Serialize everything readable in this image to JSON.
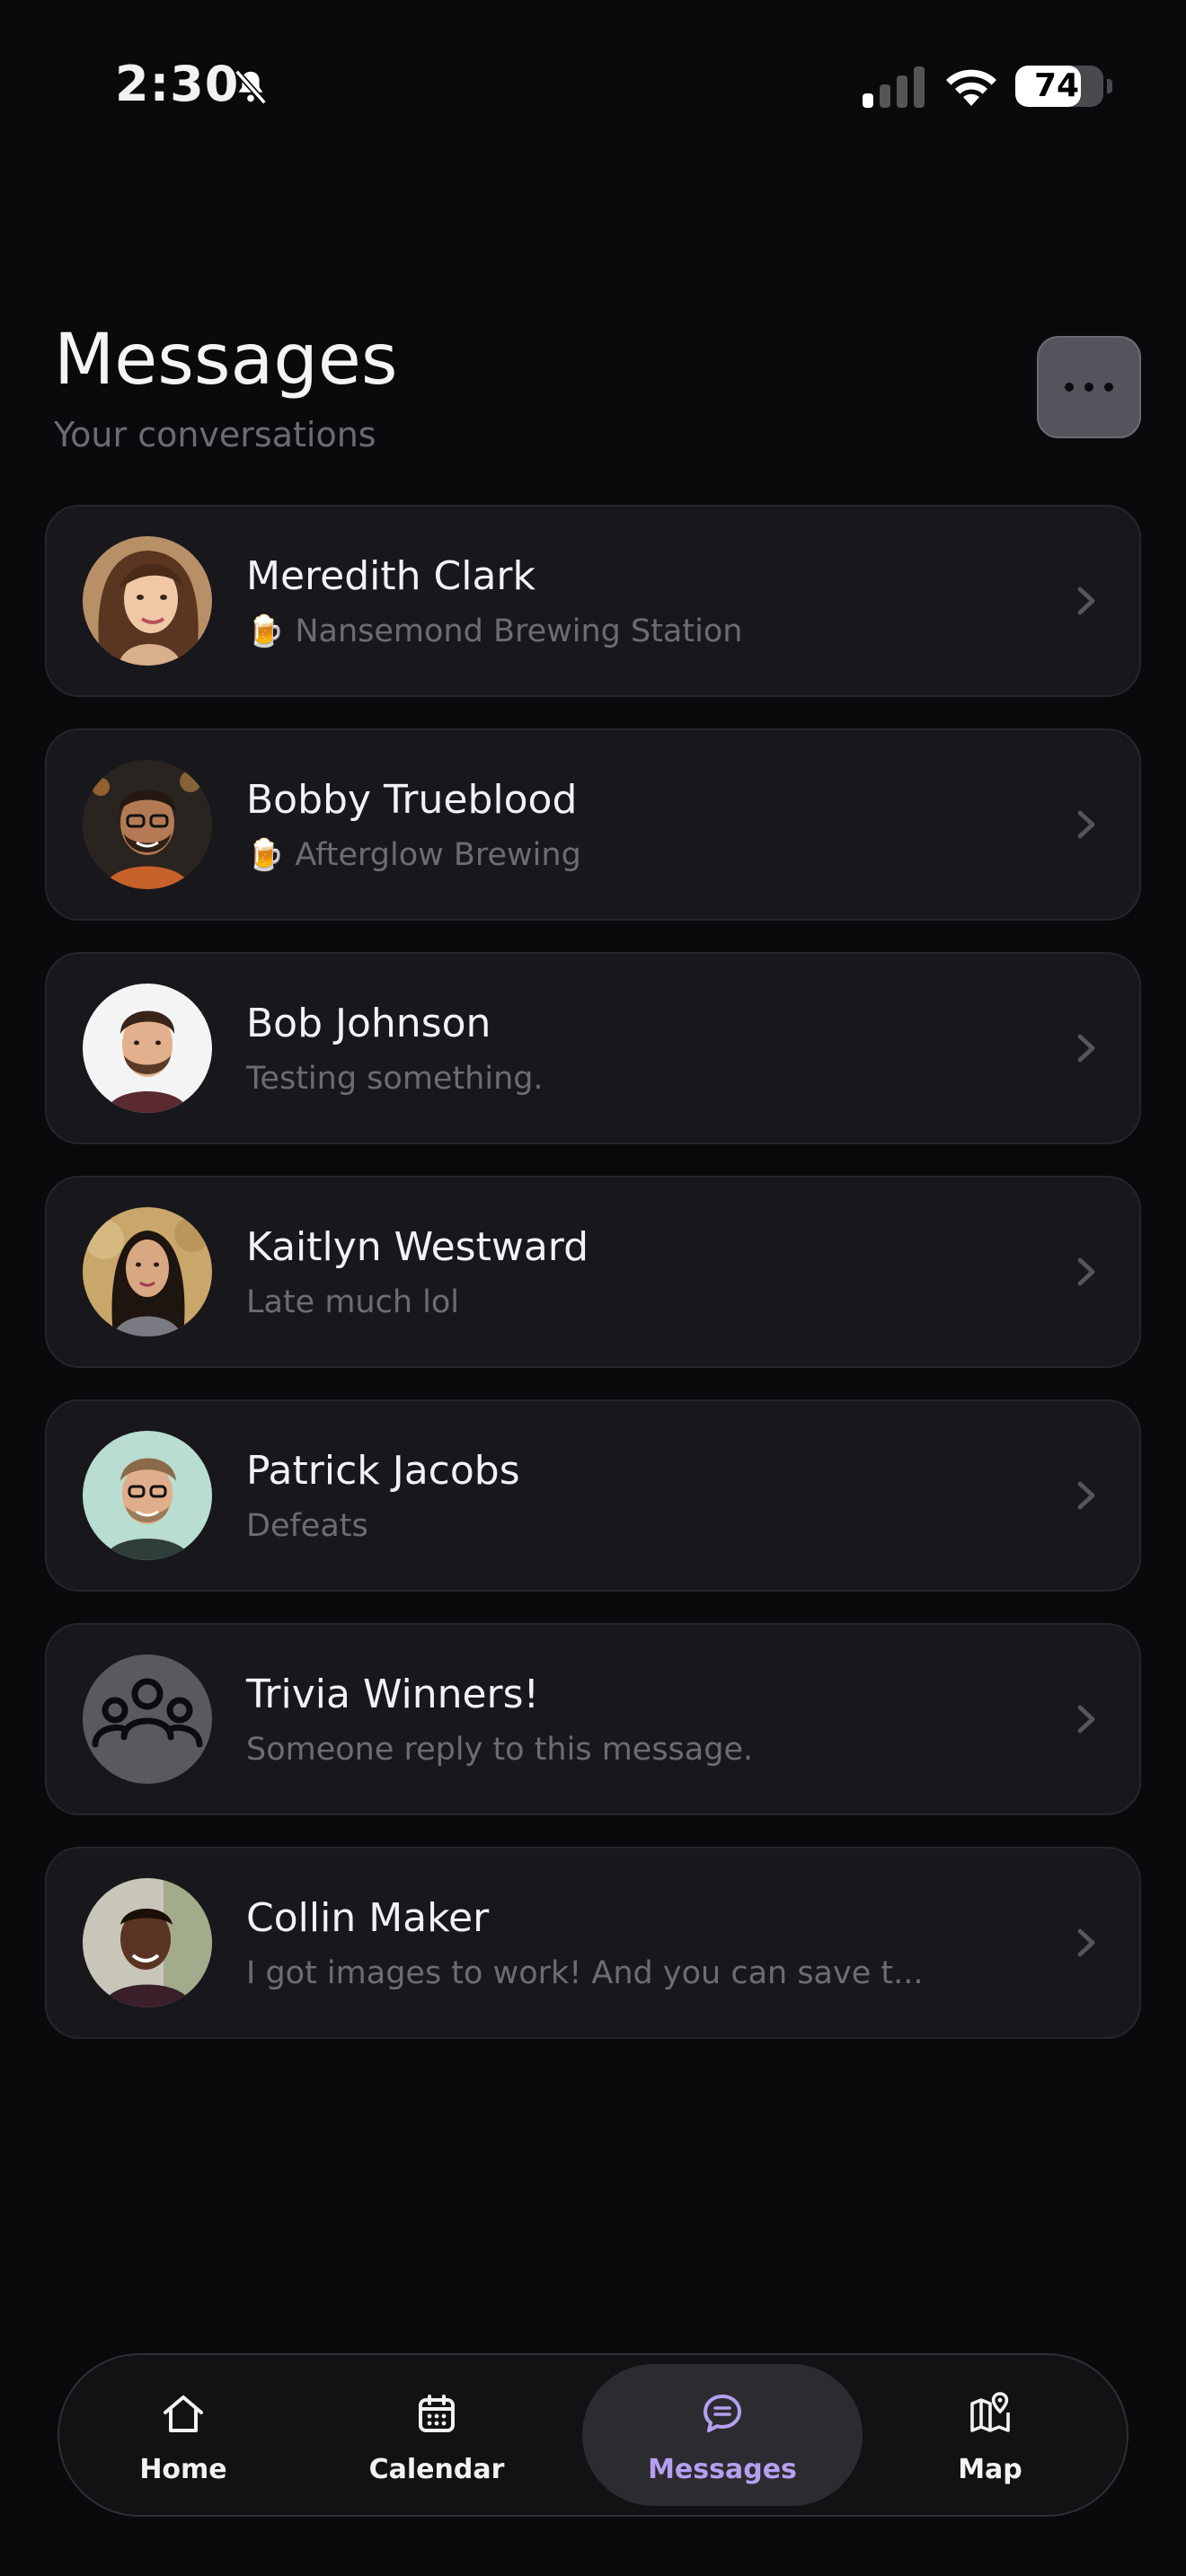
{
  "status_bar": {
    "time": "2:30",
    "battery_level": "74",
    "battery_fraction": 0.74
  },
  "header": {
    "title": "Messages",
    "subtitle": "Your conversations"
  },
  "conversations": [
    {
      "name": "Meredith Clark",
      "preview": "Nansemond Brewing Station",
      "icon": "beer-mug-icon"
    },
    {
      "name": "Bobby Trueblood",
      "preview": "Afterglow Brewing",
      "icon": "beer-mug-icon"
    },
    {
      "name": "Bob Johnson",
      "preview": "Testing something."
    },
    {
      "name": "Kaitlyn Westward",
      "preview": "Late much lol"
    },
    {
      "name": "Patrick Jacobs",
      "preview": "Defeats"
    },
    {
      "name": "Trivia Winners!",
      "preview": "Someone reply to this message."
    },
    {
      "name": "Collin Maker",
      "preview": "I got images to work! And you can save t..."
    }
  ],
  "tabs": [
    {
      "label": "Home",
      "icon": "home-icon"
    },
    {
      "label": "Calendar",
      "icon": "calendar-icon"
    },
    {
      "label": "Messages",
      "icon": "chat-bubble-icon",
      "active": true
    },
    {
      "label": "Map",
      "icon": "map-pin-icon"
    }
  ],
  "colors": {
    "accent": "#b59ff0",
    "background": "#0a0a0c",
    "card": "#18181c"
  }
}
